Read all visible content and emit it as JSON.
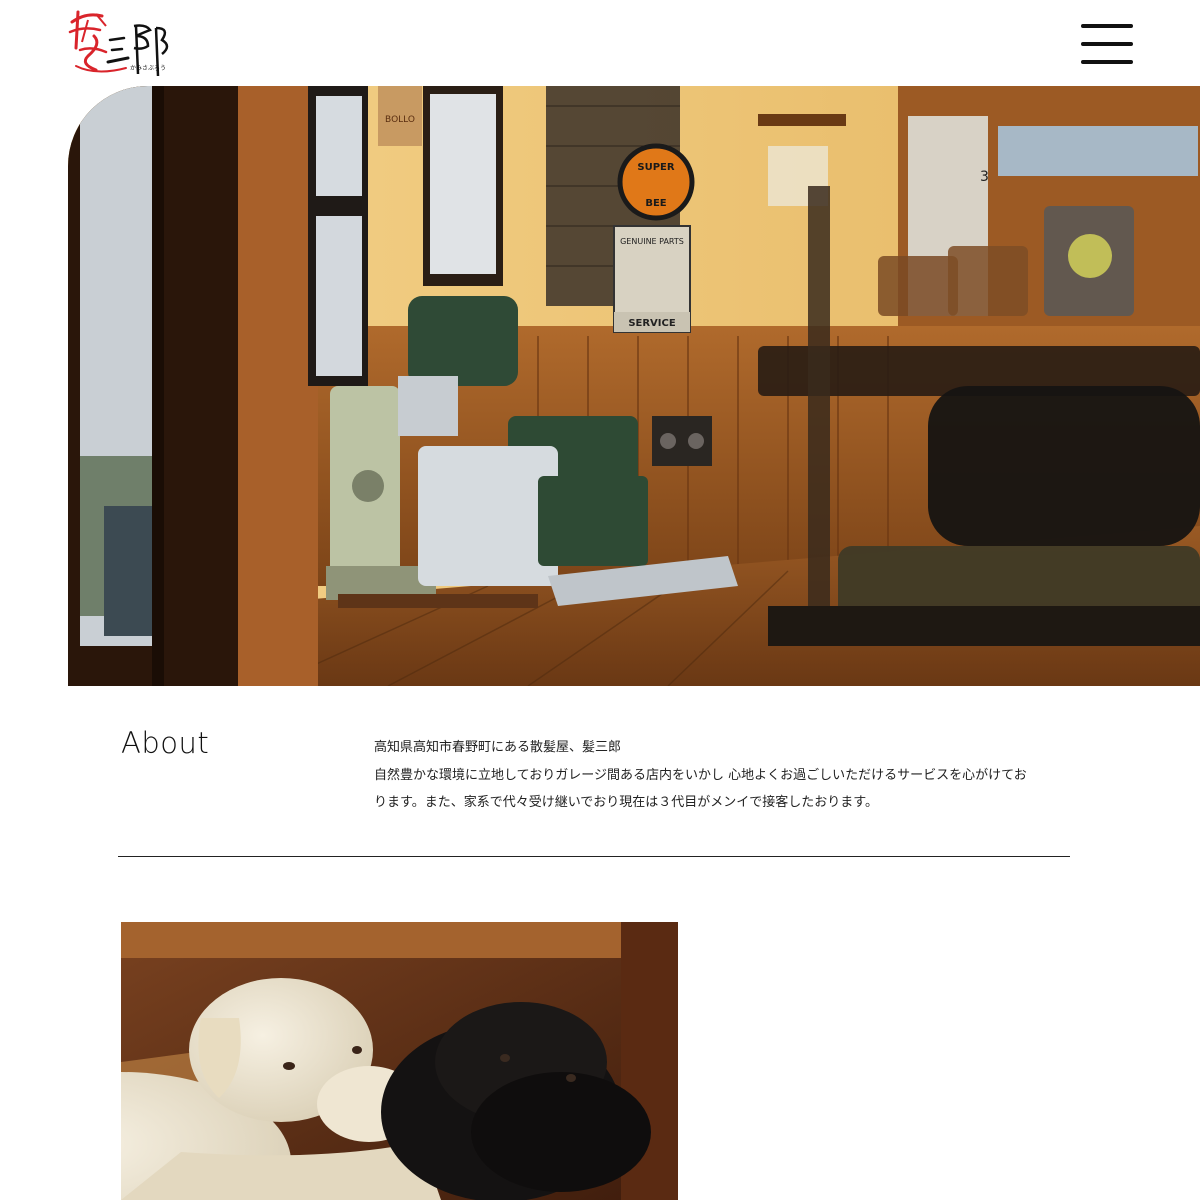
{
  "header": {
    "logo": {
      "icon": "kamisaburo-logo",
      "text": "髪三郎",
      "reading": "かみさぶろう",
      "colors": {
        "accent": "#d9242b",
        "ink": "#111111"
      }
    },
    "menu_icon": "hamburger-menu-icon"
  },
  "hero": {
    "image": "barbershop-interior-photo",
    "signs": {
      "super_bee_top": "SUPER",
      "super_bee_bottom": "BEE",
      "genuine": "GENUINE PARTS",
      "service": "SERVICE",
      "bollo": "BOLLO",
      "shelf_number": "3"
    }
  },
  "about": {
    "heading": "About",
    "line1": "高知県高知市春野町にある散髪屋、髪三郎",
    "line2": "自然豊かな環境に立地しておりガレージ間ある店内をいかし 心地よくお過ごしいただけるサービスを心がけてお",
    "line3": "ります。また、家系で代々受け継いでおり現在は３代目がメンイで接客したおります。"
  },
  "gallery": {
    "image": "two-labrador-dogs-photo"
  }
}
